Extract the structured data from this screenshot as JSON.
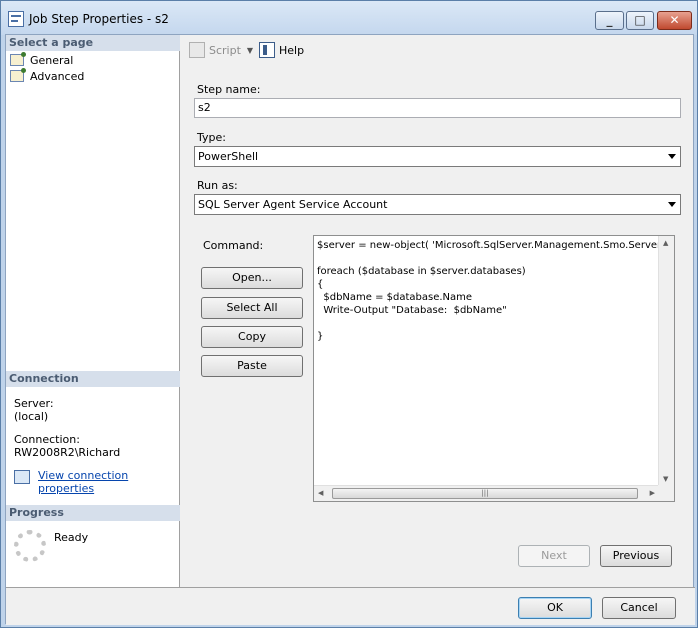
{
  "window": {
    "title": "Job Step Properties - s2"
  },
  "left": {
    "select_page_header": "Select a page",
    "pages": [
      "General",
      "Advanced"
    ],
    "connection_header": "Connection",
    "server_label": "Server:",
    "server_value": "(local)",
    "connection_label": "Connection:",
    "connection_value": "RW2008R2\\Richard",
    "view_props_link": "View connection properties",
    "progress_header": "Progress",
    "progress_status": "Ready"
  },
  "toolbar": {
    "script_label": "Script",
    "help_label": "Help"
  },
  "form": {
    "step_name_label": "Step name:",
    "step_name_value": "s2",
    "type_label": "Type:",
    "type_value": "PowerShell",
    "run_as_label": "Run as:",
    "run_as_value": "SQL Server Agent Service Account",
    "command_label": "Command:",
    "command_text": "$server = new-object( 'Microsoft.SqlServer.Management.Smo.Server' ) \"(\n\nforeach ($database in $server.databases)\n{\n  $dbName = $database.Name\n  Write-Output \"Database:  $dbName\"\n\n}",
    "open_label": "Open...",
    "select_all_label": "Select All",
    "copy_label": "Copy",
    "paste_label": "Paste",
    "next_label": "Next",
    "previous_label": "Previous"
  },
  "footer": {
    "ok_label": "OK",
    "cancel_label": "Cancel"
  }
}
